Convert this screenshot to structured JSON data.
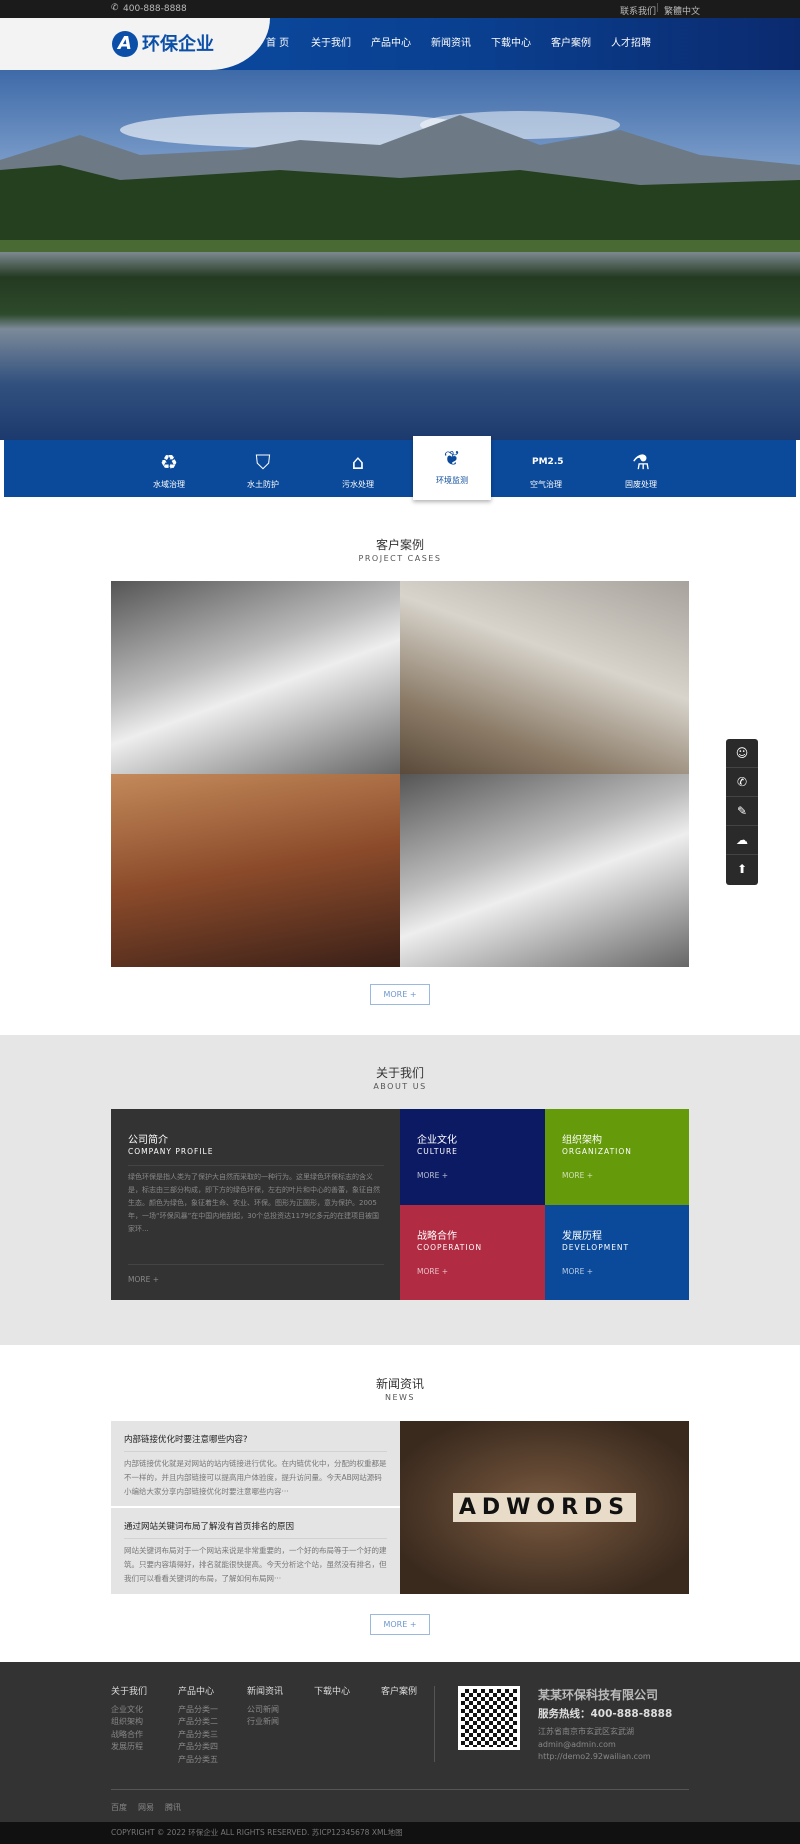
{
  "topbar": {
    "phone": "400-888-8888",
    "links": [
      "联系我们",
      "繁體中文"
    ]
  },
  "header": {
    "logo_text": "环保企业",
    "nav": [
      "首 页",
      "关于我们",
      "产品中心",
      "新闻资讯",
      "下载中心",
      "客户案例",
      "人才招聘"
    ]
  },
  "services": [
    {
      "label": "水域治理",
      "icon": "water-cycle-icon"
    },
    {
      "label": "水土防护",
      "icon": "shield-drop-icon"
    },
    {
      "label": "污水处理",
      "icon": "house-water-icon"
    },
    {
      "label": "环境监测",
      "icon": "globe-leaf-icon",
      "active": true
    },
    {
      "label": "空气治理",
      "icon": "pm25-factory-icon"
    },
    {
      "label": "固废处理",
      "icon": "flask-icon"
    }
  ],
  "cases": {
    "title": "客户案例",
    "subtitle": "PROJECT CASES",
    "more": "MORE +"
  },
  "about": {
    "title": "关于我们",
    "subtitle": "ABOUT US",
    "profile": {
      "title": "公司简介",
      "subtitle": "COMPANY PROFILE",
      "text": "绿色环保是指人类为了保护大自然而采取的一种行为。这里绿色环保标志的含义是，标志由三部分构成，即下方的绿色环保，左右的叶片和中心的善蕾，象征自然生态。颜色为绿色，象征着生命、农业、环保。图形为正圆形，意为保护。2005年，一场“环保风暴”在中国内地刮起，30个总投资达1179亿多元的在建项目被国家环...",
      "more": "MORE +"
    },
    "blocks": [
      {
        "title": "企业文化",
        "subtitle": "CULTURE",
        "more": "MORE +",
        "color": "#0c1a63"
      },
      {
        "title": "组织架构",
        "subtitle": "ORGANIZATION",
        "more": "MORE +",
        "color": "#659a0a"
      },
      {
        "title": "战略合作",
        "subtitle": "COOPERATION",
        "more": "MORE +",
        "color": "#b12b43"
      },
      {
        "title": "发展历程",
        "subtitle": "DEVELOPMENT",
        "more": "MORE +",
        "color": "#0b4a9b"
      }
    ]
  },
  "news": {
    "title": "新闻资讯",
    "subtitle": "NEWS",
    "more": "MORE +",
    "items": [
      {
        "title": "内部链接优化时要注意哪些内容?",
        "desc": "内部链接优化就是对网站的站内链接进行优化。在内链优化中，分配的权重都是不一样的，并且内部链接可以提高用户体验度，提升访问量。今天AB网站源码小编给大家分享内部链接优化时要注意哪些内容···"
      },
      {
        "title": "通过网站关键词布局了解没有首页排名的原因",
        "desc": "网站关键词布局对于一个网站来说是非常重要的，一个好的布局等于一个好的建筑。只要内容填得好，排名就能很快提高。今天分析这个站，虽然没有排名，但我们可以看看关键词的布局，了解如何布局网···"
      }
    ],
    "image_text": "ADWORDS"
  },
  "footer": {
    "cols": [
      {
        "head": "关于我们",
        "items": [
          "企业文化",
          "组织架构",
          "战略合作",
          "发展历程"
        ]
      },
      {
        "head": "产品中心",
        "items": [
          "产品分类一",
          "产品分类二",
          "产品分类三",
          "产品分类四",
          "产品分类五"
        ]
      },
      {
        "head": "新闻资讯",
        "items": [
          "公司新闻",
          "行业新闻"
        ]
      },
      {
        "head": "下载中心",
        "items": []
      },
      {
        "head": "客户案例",
        "items": []
      }
    ],
    "company": "某某环保科技有限公司",
    "hotline": "服务热线：400-888-8888",
    "address": "江苏省南京市玄武区玄武湖",
    "email": "admin@admin.com",
    "url": "http://demo2.92wailian.com",
    "links": [
      "百度",
      "网易",
      "腾讯"
    ],
    "copyright": "COPYRIGHT © 2022 环保企业 ALL RIGHTS RESERVED. 苏ICP12345678 XML地图"
  },
  "float": [
    "qq-icon",
    "phone-icon",
    "edit-icon",
    "wechat-icon",
    "arrow-up-icon"
  ]
}
